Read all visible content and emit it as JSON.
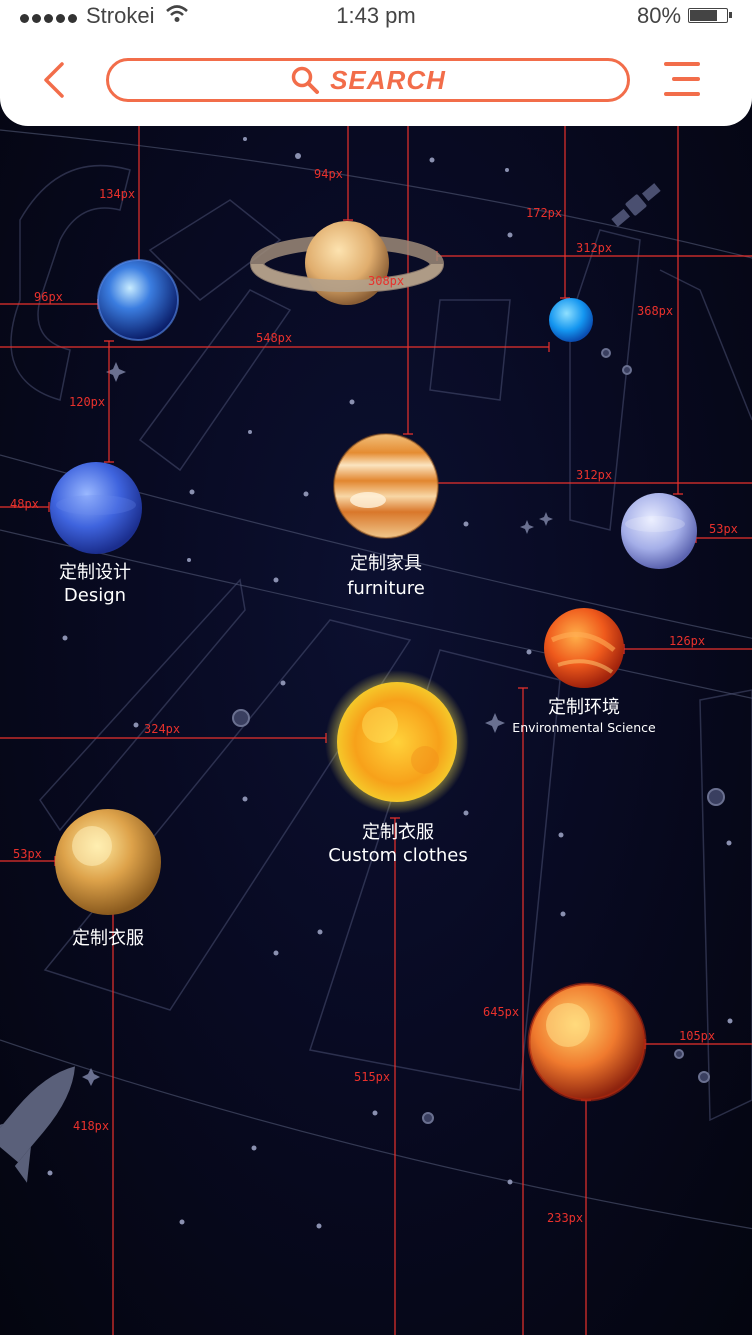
{
  "status_bar": {
    "carrier": "Strokei",
    "time": "1:43 pm",
    "battery": "80%",
    "battery_level": 0.8
  },
  "header": {
    "back_icon": "chevron-left-icon",
    "search_label": "SEARCH",
    "search_icon": "search-icon",
    "menu_icon": "hamburger-menu-icon",
    "accent_color": "#f26d4a"
  },
  "planets": {
    "design": {
      "name_cn": "定制设计",
      "name_en": "Design"
    },
    "furniture": {
      "name_cn": "定制家具",
      "name_en": "furniture"
    },
    "environment": {
      "name_cn": "定制环境",
      "name_en": "Environmental Science"
    },
    "clothes_main": {
      "name_cn": "定制衣服",
      "name_en": "Custom clothes"
    },
    "clothes": {
      "name_cn": "定制衣服"
    }
  },
  "measurements": {
    "m134": "134px",
    "m94": "94px",
    "m172": "172px",
    "m312a": "312px",
    "m96": "96px",
    "m308": "308px",
    "m368": "368px",
    "m548": "548px",
    "m120": "120px",
    "m312b": "312px",
    "m48": "48px",
    "m53a": "53px",
    "m126": "126px",
    "m324": "324px",
    "m53b": "53px",
    "m645": "645px",
    "m105": "105px",
    "m515": "515px",
    "m418": "418px",
    "m233": "233px"
  },
  "colors": {
    "measure_line": "#e8312c",
    "background": "#080a22"
  }
}
